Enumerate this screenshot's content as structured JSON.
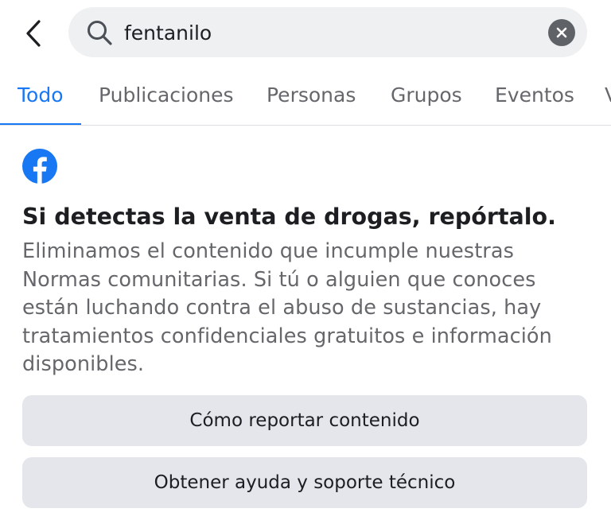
{
  "search": {
    "value": "fentanilo",
    "placeholder": ""
  },
  "tabs": [
    {
      "label": "Todo",
      "active": true
    },
    {
      "label": "Publicaciones",
      "active": false
    },
    {
      "label": "Personas",
      "active": false
    },
    {
      "label": "Grupos",
      "active": false
    },
    {
      "label": "Eventos",
      "active": false
    },
    {
      "label": "Videos",
      "active": false
    }
  ],
  "notice": {
    "title": "Si detectas la venta de drogas, repórtalo.",
    "body": "Eliminamos el contenido que incumple nuestras Normas comunitarias. Si tú o alguien que conoces están luchando contra el abuso de sustancias, hay tratamientos confidenciales gratuitos e información disponibles.",
    "report_button": "Cómo reportar contenido",
    "help_button": "Obtener ayuda y soporte técnico"
  },
  "icons": {
    "back": "chevron-left-icon",
    "search": "search-icon",
    "clear": "clear-icon",
    "brand": "facebook-logo-icon"
  },
  "colors": {
    "accent": "#1877f2",
    "text_primary": "#1c1e21",
    "text_secondary": "#65676b",
    "button_bg": "#e4e6eb",
    "search_bg": "#eef0f2"
  }
}
